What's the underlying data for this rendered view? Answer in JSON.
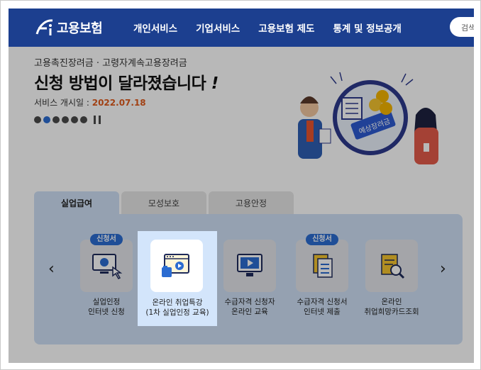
{
  "header": {
    "logo_text": "고용보험",
    "nav": [
      "개인서비스",
      "기업서비스",
      "고용보험 제도",
      "통계 및 정보공개"
    ],
    "search_label": "검색"
  },
  "hero": {
    "subtitle": "고용촉진장려금 · 고령자계속고용장려금",
    "title": "신청 방법이 달라졌습니다",
    "title_mark": "!",
    "date_label": "서비스 개시일 : ",
    "date_value": "2022.07.18",
    "illustration_badge": "예상장려금",
    "slide_count": 6,
    "active_slide": 2
  },
  "tabs": [
    "실업급여",
    "모성보호",
    "고용안정"
  ],
  "active_tab": 0,
  "services": [
    {
      "label1": "실업인정",
      "label2": "인터넷 신청",
      "badge": "신청서"
    },
    {
      "label1": "온라인 취업특강",
      "label2": "(1차 실업인정 교육)",
      "badge": ""
    },
    {
      "label1": "수급자격 신청자",
      "label2": "온라인 교육",
      "badge": ""
    },
    {
      "label1": "수급자격 신청서",
      "label2": "인터넷 제출",
      "badge": "신청서"
    },
    {
      "label1": "온라인",
      "label2": "취업희망카드조회",
      "badge": ""
    }
  ],
  "colors": {
    "header": "#1c3f8f",
    "accent": "#2b6cd1",
    "date": "#e05a1c",
    "panel": "#cfe0f5"
  }
}
